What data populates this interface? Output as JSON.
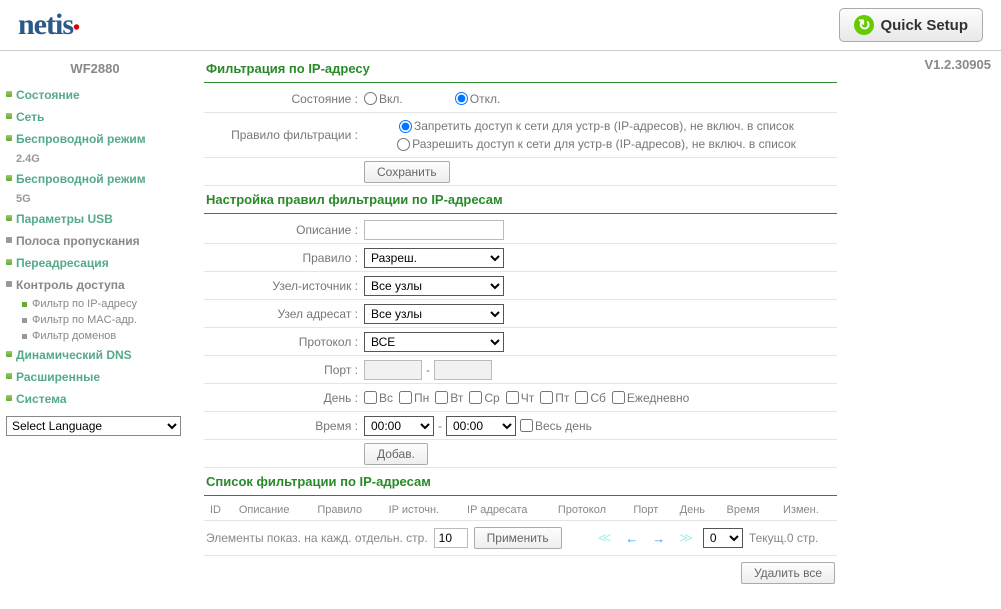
{
  "logo": "netis",
  "quick_setup": "Quick Setup",
  "model": "WF2880",
  "version": "V1.2.30905",
  "sidebar": {
    "items": [
      {
        "label": "Состояние"
      },
      {
        "label": "Сеть"
      },
      {
        "label": "Беспроводной режим",
        "sub": "2.4G"
      },
      {
        "label": "Беспроводной режим",
        "sub": "5G"
      },
      {
        "label": "Параметры USB"
      },
      {
        "label": "Полоса пропускания"
      },
      {
        "label": "Переадресация"
      },
      {
        "label": "Контроль доступа",
        "children": [
          {
            "label": "Фильтр по IP-адресу"
          },
          {
            "label": "Фильтр по MAC-адр."
          },
          {
            "label": "Фильтр доменов"
          }
        ]
      },
      {
        "label": "Динамический DNS"
      },
      {
        "label": "Расширенные"
      },
      {
        "label": "Система"
      }
    ],
    "lang": "Select Language"
  },
  "section1": {
    "title": "Фильтрация по IP-адресу",
    "status_label": "Состояние :",
    "on": "Вкл.",
    "off": "Откл.",
    "rule_label": "Правило фильтрации :",
    "deny": "Запретить доступ к сети для устр-в (IP-адресов), не включ. в список",
    "allow": "Разрешить доступ к сети для устр-в (IP-адресов), не включ. в список",
    "save": "Сохранить"
  },
  "section2": {
    "title": "Настройка правил фильтрации по IP-адресам",
    "desc": "Описание :",
    "rule": "Правило :",
    "rule_val": "Разреш.",
    "src": "Узел-источник :",
    "dst": "Узел адресат :",
    "all_nodes": "Все узлы",
    "proto": "Протокол :",
    "proto_val": "ВСЕ",
    "port": "Порт :",
    "day": "День :",
    "days": [
      "Вс",
      "Пн",
      "Вт",
      "Ср",
      "Чт",
      "Пт",
      "Сб",
      "Ежедневно"
    ],
    "time": "Время :",
    "time_val": "00:00",
    "allday": "Весь день",
    "add": "Добав."
  },
  "section3": {
    "title": "Список фильтрации по IP-адресам",
    "cols": [
      "ID",
      "Описание",
      "Правило",
      "IP источн.",
      "IP адресата",
      "Протокол",
      "Порт",
      "День",
      "Время",
      "Измен."
    ],
    "pager_text": "Элементы показ. на кажд. отдельн. стр.",
    "per_page": "10",
    "apply": "Применить",
    "cur": "0",
    "cur_label": "Текущ.0 стр.",
    "delete_all": "Удалить все"
  }
}
